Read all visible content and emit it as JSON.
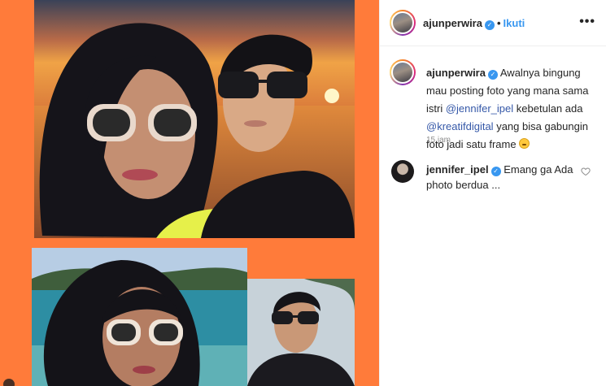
{
  "post": {
    "username": "ajunperwira",
    "verified_icon": "verified-badge-icon",
    "separator": "•",
    "follow_label": "Ikuti",
    "more_icon": "more-options-icon",
    "more_glyph": "•••"
  },
  "caption": {
    "username": "ajunperwira",
    "text_before_mention1": "Awalnya bingung mau posting foto yang mana sama istri",
    "mention1": "@jennifer_ipel",
    "text_after_mention1": "kebetulan ada",
    "mention2": "@kreatifdigital",
    "text_after_mention2": "yang bisa gabungin foto jadi satu frame",
    "emoji": "grimacing-face-emoji",
    "timestamp": "15 jam"
  },
  "comments": [
    {
      "username": "jennifer_ipel",
      "text": "Emang ga Ada photo berdua ...",
      "like_icon": "heart-icon"
    }
  ],
  "colors": {
    "frame_orange": "#ff7b3a",
    "link_blue": "#3897f0",
    "mention_blue": "#3558a8",
    "muted_gray": "#8e8e8e"
  }
}
